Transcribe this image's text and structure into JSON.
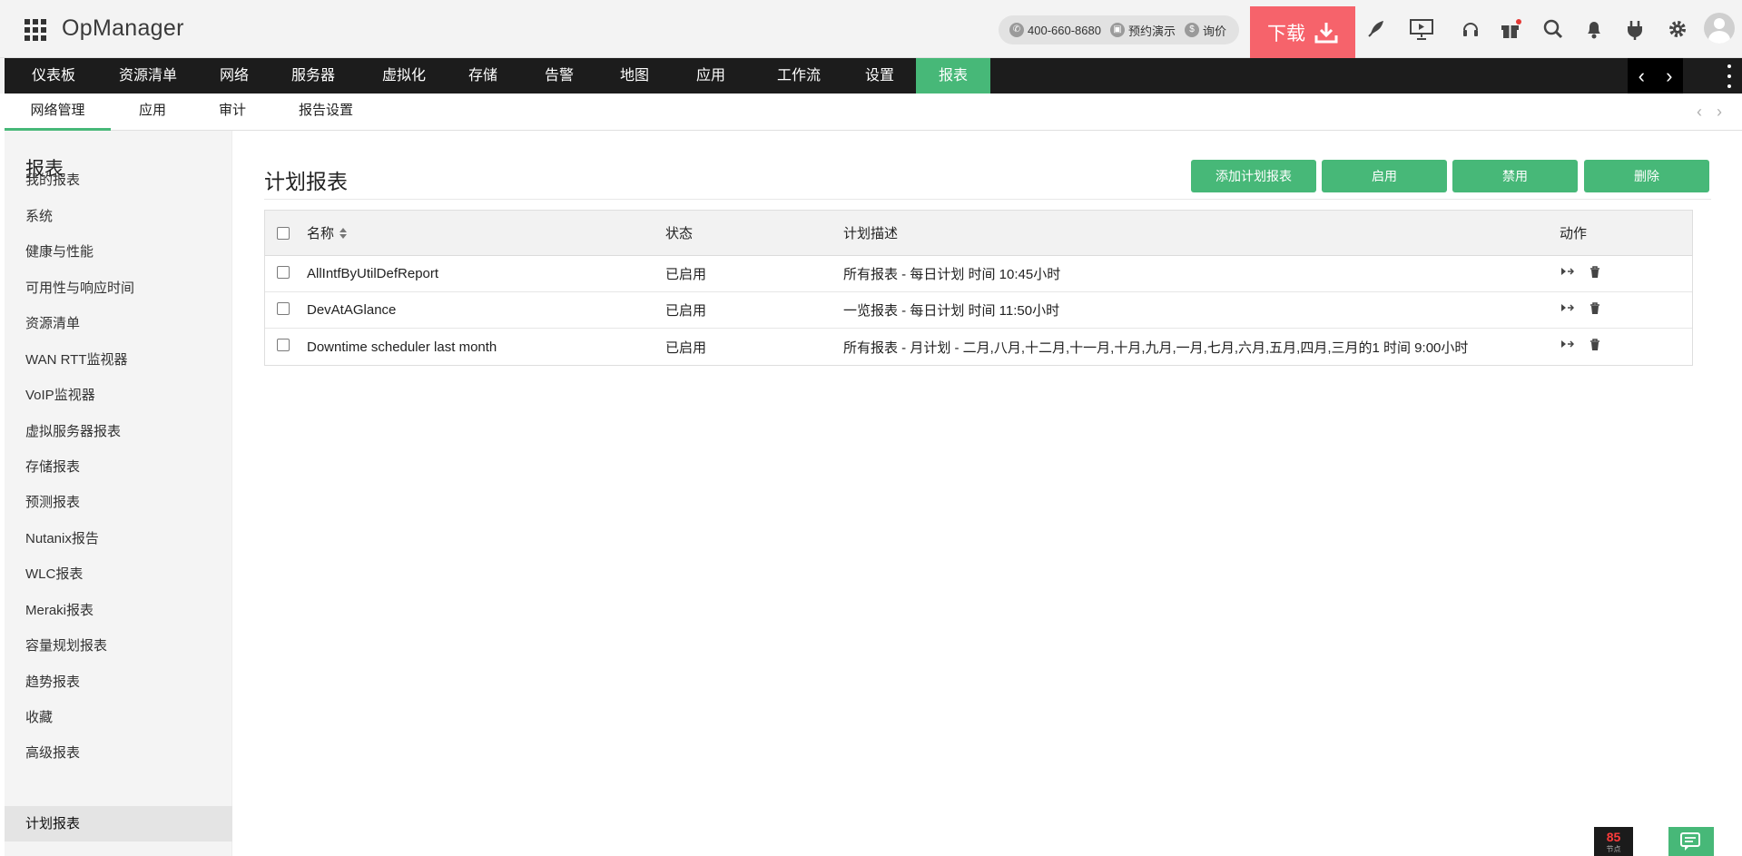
{
  "header": {
    "logo": "OpManager",
    "phone": "400-660-8680",
    "demo": "预约演示",
    "inquiry": "询价",
    "download_label": "下载"
  },
  "mainnav": {
    "items": [
      "仪表板",
      "资源清单",
      "网络",
      "服务器",
      "虚拟化",
      "存储",
      "告警",
      "地图",
      "应用",
      "工作流",
      "设置",
      "报表"
    ],
    "active": "报表"
  },
  "subnav": {
    "items": [
      "网络管理",
      "应用",
      "审计",
      "报告设置"
    ],
    "active": "网络管理"
  },
  "sidebar": {
    "title": "报表",
    "items": [
      "我的报表",
      "系统",
      "健康与性能",
      "可用性与响应时间",
      "资源清单",
      "WAN RTT监视器",
      "VoIP监视器",
      "虚拟服务器报表",
      "存储报表",
      "预测报表",
      "Nutanix报告",
      "WLC报表",
      "Meraki报表",
      "容量规划报表",
      "趋势报表",
      "收藏",
      "高级报表",
      "计划报表"
    ],
    "active": "计划报表"
  },
  "main": {
    "title": "计划报表",
    "buttons": {
      "add": "添加计划报表",
      "enable": "启用",
      "disable": "禁用",
      "delete": "删除"
    },
    "table": {
      "headers": {
        "name": "名称",
        "status": "状态",
        "description": "计划描述",
        "action": "动作"
      },
      "rows": [
        {
          "name": "AllIntfByUtilDefReport",
          "status": "已启用",
          "description": "所有报表 - 每日计划 时间 10:45小时"
        },
        {
          "name": "DevAtAGlance",
          "status": "已启用",
          "description": "一览报表 - 每日计划 时间 11:50小时"
        },
        {
          "name": "Downtime scheduler last month",
          "status": "已启用",
          "description": "所有报表 - 月计划 - 二月,八月,十二月,十一月,十月,九月,一月,七月,六月,五月,四月,三月的1 时间 9:00小时"
        }
      ]
    }
  },
  "widgets": {
    "score": "85",
    "score_caption": "节点"
  },
  "colors": {
    "accent": "#47b878",
    "download": "#f6636b",
    "navbar": "#1c1c1c"
  }
}
